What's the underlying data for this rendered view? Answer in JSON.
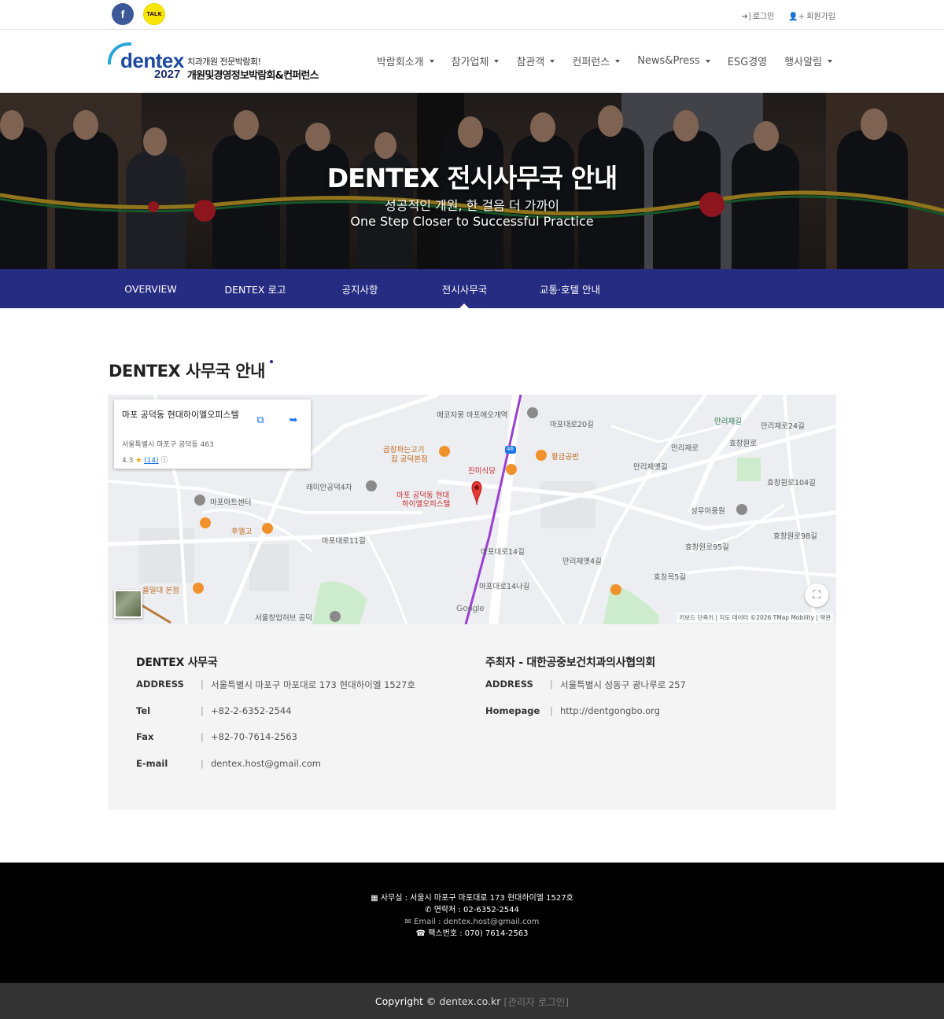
{
  "topbar": {
    "facebook_icon": "facebook-icon",
    "facebook_label": "f",
    "kakao_label": "TALK",
    "login": "로그인",
    "signup": "회원가입"
  },
  "header": {
    "logo_word": "dentex",
    "logo_year": "2027",
    "logo_tagline": "치과개원 전문박람회!",
    "logo_name": "개원및경영정보박람회&컨퍼런스",
    "menu": [
      {
        "label": "박람회소개",
        "dropdown": true
      },
      {
        "label": "참가업체",
        "dropdown": true
      },
      {
        "label": "참관객",
        "dropdown": true
      },
      {
        "label": "컨퍼런스",
        "dropdown": true
      },
      {
        "label": "News&Press",
        "dropdown": true
      },
      {
        "label": "ESG경영",
        "dropdown": false
      },
      {
        "label": "행사알림",
        "dropdown": true
      }
    ]
  },
  "hero": {
    "title": "DENTEX 전시사무국 안내",
    "subtitle_ko": "성공적인 개원, 한 걸음 더 가까이",
    "subtitle_en": "One Step Closer to Successful Practice"
  },
  "subnav": {
    "tabs": [
      {
        "label": "OVERVIEW",
        "active": false
      },
      {
        "label": "DENTEX 로고",
        "active": false
      },
      {
        "label": "공지사항",
        "active": false
      },
      {
        "label": "전시사무국",
        "active": true
      },
      {
        "label": "교통·호텔 안내",
        "active": false
      }
    ]
  },
  "section": {
    "title": "DENTEX 사무국 안내"
  },
  "map": {
    "card": {
      "name": "마포 공덕동 현대하이엘오피스텔",
      "address": "서울특별시 마포구 공덕동 463",
      "rating": "4.3",
      "reviews": "(14)"
    },
    "pin_label_1": "마포 공덕동 현대",
    "pin_label_2": "하이엘오피스텔",
    "labels": [
      {
        "text": "에코자몽 마포애오개역",
        "style": "gray"
      },
      {
        "text": "마포대로20길",
        "style": "gray"
      },
      {
        "text": "만리재길",
        "style": "green"
      },
      {
        "text": "만리재로24길",
        "style": "gray"
      },
      {
        "text": "곱창파는고기",
        "style": "orange"
      },
      {
        "text": "집 공덕본점",
        "style": "orange"
      },
      {
        "text": "황금공반",
        "style": "orange"
      },
      {
        "text": "진미식당",
        "style": "red"
      },
      {
        "text": "래미안공덕4차",
        "style": "gray"
      },
      {
        "text": "마포아트센터",
        "style": "gray"
      },
      {
        "text": "후엘고",
        "style": "orange"
      },
      {
        "text": "마포대로11길",
        "style": "gray"
      },
      {
        "text": "마포대로14길",
        "style": "gray"
      },
      {
        "text": "만리재옛4길",
        "style": "gray"
      },
      {
        "text": "성우이용원",
        "style": "gray"
      },
      {
        "text": "효창원로95길",
        "style": "gray"
      },
      {
        "text": "효창원로104길",
        "style": "gray"
      },
      {
        "text": "효창원로98길",
        "style": "gray"
      },
      {
        "text": "효창목5길",
        "style": "gray"
      },
      {
        "text": "을밀대 본점",
        "style": "orange"
      },
      {
        "text": "서울창업허브 공덕",
        "style": "gray"
      },
      {
        "text": "마포대로14나길",
        "style": "gray"
      },
      {
        "text": "만리재옛길",
        "style": "gray"
      },
      {
        "text": "만리재로",
        "style": "gray"
      },
      {
        "text": "효창원로",
        "style": "gray"
      }
    ],
    "route_badge": "46",
    "google": "Google",
    "attribution": "키보드 단축키 | 지도 데이터 ©2026 TMap Mobility | 약관",
    "open_icon": "open-in-new-icon",
    "directions_icon": "directions-icon",
    "fullscreen_icon": "fullscreen-icon"
  },
  "office": {
    "title": "DENTEX 사무국",
    "rows": [
      {
        "key": "ADDRESS",
        "value": "서울특별시 마포구 마포대로 173 현대하이엘 1527호"
      },
      {
        "key": "Tel",
        "value": "+82-2-6352-2544"
      },
      {
        "key": "Fax",
        "value": "+82-70-7614-2563"
      },
      {
        "key": "E-mail",
        "value": "dentex.host@gmail.com"
      }
    ]
  },
  "host": {
    "title": "주최자 - 대한공중보건치과의사협의회",
    "rows": [
      {
        "key": "ADDRESS",
        "value": "서울특별시 성동구 광나루로 257"
      },
      {
        "key": "Homepage",
        "value": "http://dentgongbo.org"
      }
    ]
  },
  "footer": {
    "office": "사무실 : 서울시 마포구 마포대로 173 현대하이엘 1527호",
    "phone": "연락처 : 02-6352-2544",
    "email": "Email : dentex.host@gmail.com",
    "fax": "팩스번호 : 070) 7614-2563",
    "copyright": "Copyright ©",
    "domain": "dentex.co.kr",
    "admin": "[관리자 로그인]"
  },
  "colors": {
    "brand_navy": "#252c82",
    "footer_bg": "#000000",
    "copyright_bg": "#333333",
    "info_bg": "#f4f4f4"
  }
}
